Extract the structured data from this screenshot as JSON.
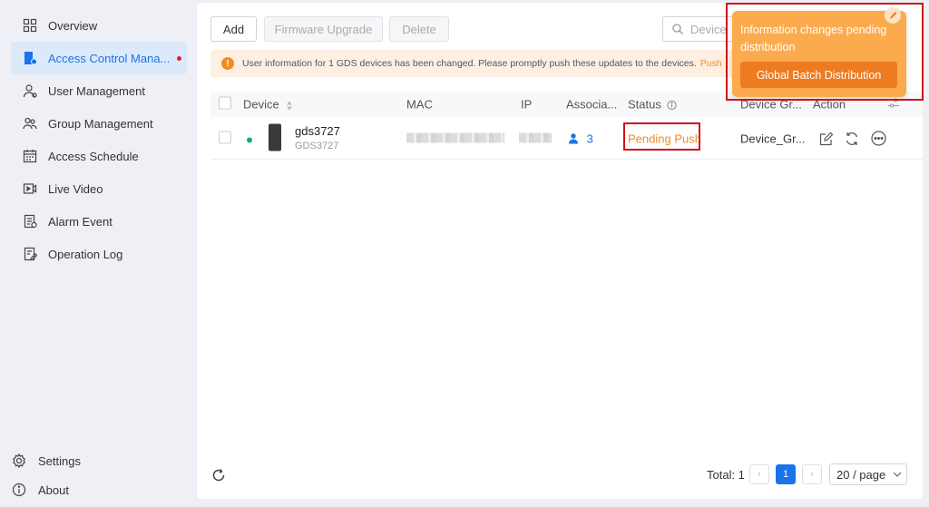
{
  "sidebar": {
    "items": [
      {
        "label": "Overview",
        "icon": "grid-icon"
      },
      {
        "label": "Access Control Mana...",
        "icon": "access-control-icon",
        "active": true
      },
      {
        "label": "User Management",
        "icon": "user-icon"
      },
      {
        "label": "Group Management",
        "icon": "group-icon"
      },
      {
        "label": "Access Schedule",
        "icon": "calendar-icon"
      },
      {
        "label": "Live Video",
        "icon": "video-icon"
      },
      {
        "label": "Alarm Event",
        "icon": "alarm-icon"
      },
      {
        "label": "Operation Log",
        "icon": "log-icon"
      }
    ],
    "settings_label": "Settings",
    "about_label": "About"
  },
  "toolbar": {
    "add_label": "Add",
    "firmware_label": "Firmware Upgrade",
    "delete_label": "Delete",
    "search_placeholder": "Device"
  },
  "alert": {
    "message": "User information for 1 GDS devices has been changed. Please promptly push these updates to the devices.",
    "link": "Push"
  },
  "table": {
    "columns": [
      "Device",
      "MAC",
      "IP",
      "Associa...",
      "Status",
      "Device Gr...",
      "Action"
    ],
    "rows": [
      {
        "name": "gds3727",
        "model": "GDS3727",
        "associated": "3",
        "status": "Pending Push",
        "group": "Device_Gr..."
      }
    ]
  },
  "pagination": {
    "total": "Total: 1",
    "current_page": "1",
    "page_size": "20 / page"
  },
  "popup": {
    "message": "Information changes pending distribution",
    "button": "Global Batch Distribution"
  },
  "colors": {
    "accent": "#1a73e8",
    "warning": "#f08c22",
    "highlight": "#d0111c",
    "online": "#1aad6a"
  }
}
